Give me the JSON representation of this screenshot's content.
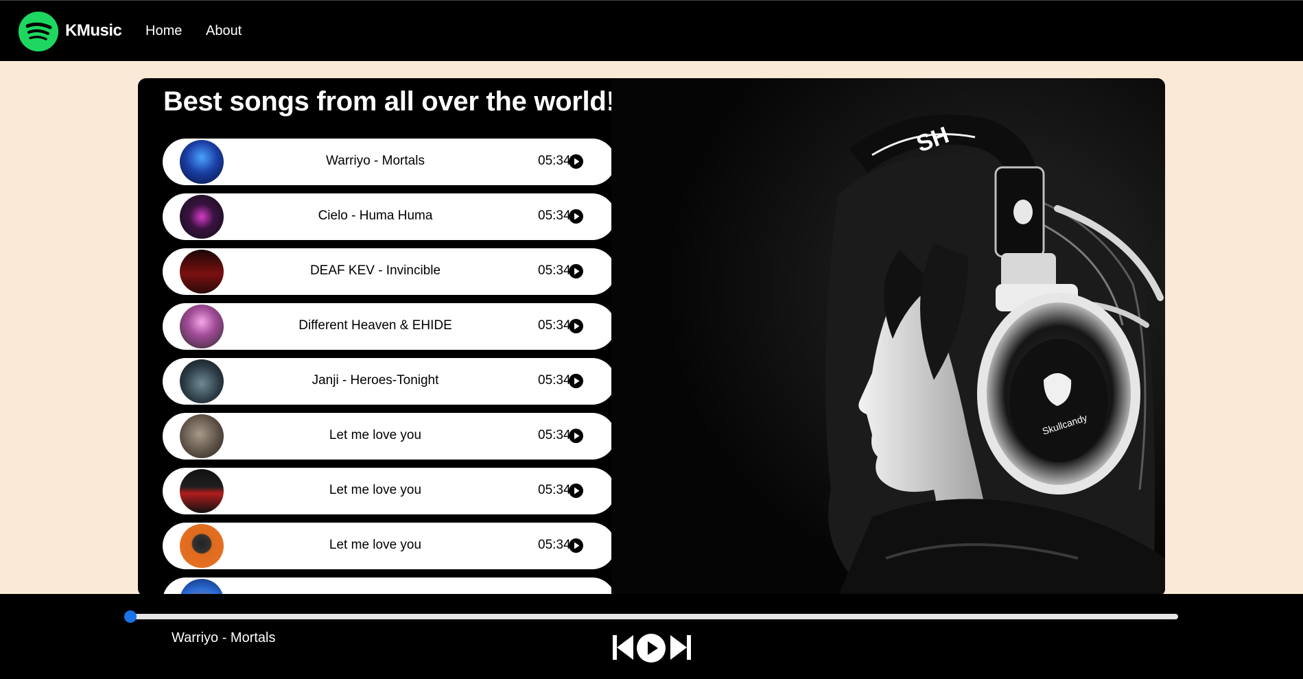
{
  "navbar": {
    "brand": "KMusic",
    "links": [
      "Home",
      "About"
    ],
    "logo_icon": "spotify-logo-icon",
    "logo_color": "#1ed760"
  },
  "main": {
    "title": "Best songs from all over the world!!",
    "songs": [
      {
        "name": "Warriyo - Mortals",
        "duration": "05:34"
      },
      {
        "name": "Cielo - Huma Huma",
        "duration": "05:34"
      },
      {
        "name": "DEAF KEV - Invincible",
        "duration": "05:34"
      },
      {
        "name": "Different Heaven & EHIDE",
        "duration": "05:34"
      },
      {
        "name": "Janji - Heroes-Tonight",
        "duration": "05:34"
      },
      {
        "name": "Let me love you",
        "duration": "05:34"
      },
      {
        "name": "Let me love you",
        "duration": "05:34"
      },
      {
        "name": "Let me love you",
        "duration": "05:34"
      },
      {
        "name": "",
        "duration": ""
      }
    ]
  },
  "player": {
    "now_playing": "Warriyo - Mortals",
    "progress": 0,
    "accent_color": "#1a73e8",
    "controls": [
      "previous-icon",
      "play-icon",
      "next-icon"
    ]
  },
  "colors": {
    "page_background": "#fae9d6",
    "bar_background": "#000000"
  }
}
